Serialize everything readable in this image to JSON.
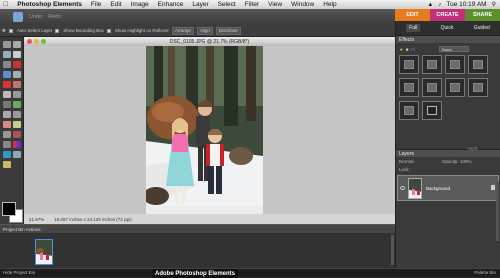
{
  "menubar": {
    "apple": "",
    "app": "Photoshop Elements",
    "items": [
      "File",
      "Edit",
      "Image",
      "Enhance",
      "Layer",
      "Select",
      "Filter",
      "View",
      "Window",
      "Help"
    ],
    "clock": "Tue 10:19 AM"
  },
  "topbar": {
    "undo": "Undo",
    "redo": "Redo"
  },
  "modes_top": {
    "edit": "EDIT",
    "create": "CREATE",
    "share": "SHARE"
  },
  "options": {
    "auto_select": "Auto Select Layer",
    "bounding": "Show Bounding Box",
    "highlight": "Show Highlight on Rollover",
    "arrange": "Arrange",
    "align": "Align",
    "distribute": "Distribute"
  },
  "document": {
    "title": "DSC_0105.JPG @ 21.7% (RGB/8*)",
    "zoom": "21.67%",
    "size": "16.097 inches x 24.129 inches (72 ppi)"
  },
  "bin": {
    "title": "Project Bin Actions"
  },
  "footer": {
    "hide_bin": "Hide Project Bin",
    "dock_label": "Adobe Photoshop Elements",
    "palette_bin": "Palette Bin"
  },
  "right_panel": {
    "modes": [
      "Full",
      "Quick",
      "Guided"
    ],
    "effects_title": "Effects",
    "effects_dropdown": "Basic",
    "apply": "Apply",
    "layers_title": "Layers",
    "blend": "Normal",
    "opacity_label": "Opacity:",
    "opacity": "100%",
    "lock_label": "Lock:",
    "layer_name": "Background"
  },
  "colors": {
    "edit": "#e87b1e",
    "create": "#c2307a",
    "share": "#5a8f2a"
  }
}
